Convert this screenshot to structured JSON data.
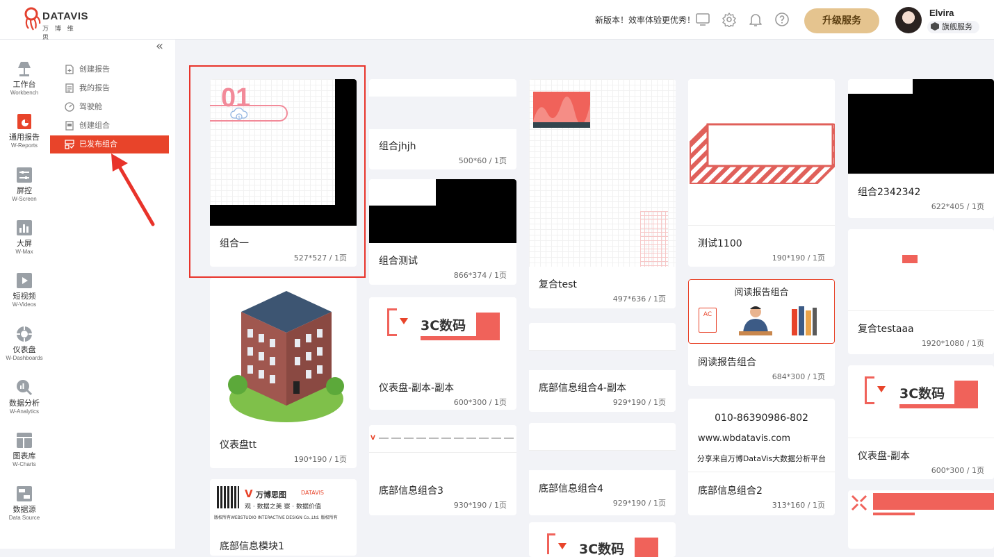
{
  "header": {
    "logo_text": "DATAVIS",
    "logo_sub": "万 博 维 思",
    "notice": "新版本！效率体验更优秀！",
    "upgrade_label": "升级服务",
    "user_name": "Elvira",
    "user_tier": "旗舰服务"
  },
  "rail": [
    {
      "cn": "工作台",
      "en": "Workbench"
    },
    {
      "cn": "通用报告",
      "en": "W-Reports"
    },
    {
      "cn": "屏控",
      "en": "W-Screen"
    },
    {
      "cn": "大屏",
      "en": "W-Max"
    },
    {
      "cn": "短视频",
      "en": "W-Videos"
    },
    {
      "cn": "仪表盘",
      "en": "W-Dashboards"
    },
    {
      "cn": "数据分析",
      "en": "W-Analytics"
    },
    {
      "cn": "图表库",
      "en": "W-Charts"
    },
    {
      "cn": "数据源",
      "en": "Data Source"
    }
  ],
  "submenu": [
    {
      "label": "创建报告"
    },
    {
      "label": "我的报告"
    },
    {
      "label": "驾驶舱"
    },
    {
      "label": "创建组合"
    },
    {
      "label": "已发布组合"
    }
  ],
  "colors": {
    "accent": "#e8442a",
    "upgrade": "#e5c48f",
    "thumb_red": "#f0625a"
  },
  "cards": [
    {
      "name": "组合一",
      "meta": "527*527 / 1页"
    },
    {
      "name": "仪表盘tt",
      "meta": "190*190 / 1页"
    },
    {
      "name": "底部信息模块1",
      "meta": ""
    },
    {
      "name": "组合jhjh",
      "meta": "500*60 / 1页"
    },
    {
      "name": "组合测试",
      "meta": "866*374 / 1页"
    },
    {
      "name": "仪表盘-副本-副本",
      "meta": "600*300 / 1页"
    },
    {
      "name": "底部信息组合3",
      "meta": "930*190 / 1页"
    },
    {
      "name": "复合test",
      "meta": "497*636 / 1页"
    },
    {
      "name": "底部信息组合4-副本",
      "meta": "929*190 / 1页"
    },
    {
      "name": "底部信息组合4",
      "meta": "929*190 / 1页"
    },
    {
      "name": "测试1100",
      "meta": "190*190 / 1页"
    },
    {
      "name": "阅读报告组合",
      "meta": "684*300 / 1页"
    },
    {
      "name": "底部信息组合2",
      "meta": "313*160 / 1页"
    },
    {
      "name": "组合2342342",
      "meta": "622*405 / 1页"
    },
    {
      "name": "复合testaaa",
      "meta": "1920*1080 / 1页"
    },
    {
      "name": "仪表盘-副本",
      "meta": "600*300 / 1页"
    }
  ],
  "thumb_text": {
    "big_number": "01",
    "digital_3c": "3C数码",
    "reading_title": "阅读报告组合",
    "reading_badge": "AC",
    "phone": "010-86390986-802",
    "website": "www.wbdatavis.com",
    "share": "分享来自万博DataVis大数据分析平台",
    "footer_brand": "万博思图",
    "footer_brand2": "DATAVIS",
    "footer_slogan": "观 · 数据之美   察 · 数据价值",
    "footer_copyright": "版权所有WEBSTUDIO INTERACTIVE DESIGN Co.,Ltd. 版权所有"
  }
}
